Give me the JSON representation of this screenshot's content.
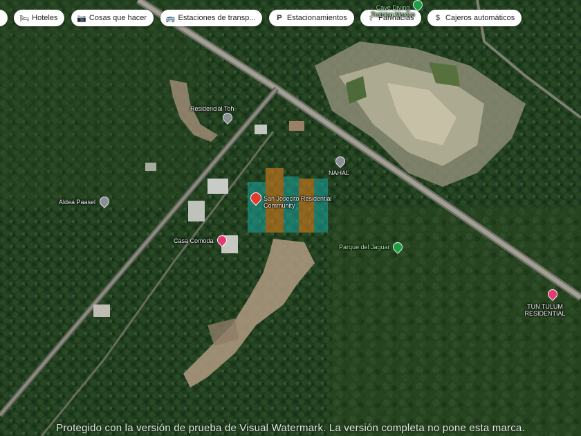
{
  "filters": [
    {
      "label": "tes",
      "icon": "none"
    },
    {
      "label": "Hoteles",
      "icon": "bed-icon"
    },
    {
      "label": "Cosas que hacer",
      "icon": "camera-icon"
    },
    {
      "label": "Estaciones de transp...",
      "icon": "bus-icon"
    },
    {
      "label": "Estacionamientos",
      "icon": "parking-icon"
    },
    {
      "label": "Farmacias",
      "icon": "pharmacy-icon"
    },
    {
      "label": "Cajeros automáticos",
      "icon": "atm-icon"
    }
  ],
  "places": {
    "residencial_toh": "Residencial Toh",
    "nahal": "NAHAL",
    "aldea_paasel": "Aldea Paasel",
    "san_josecito": "San Josecito Residential Community",
    "casa_comoda": "Casa Comoda",
    "parque_jaguar": "Parque del Jaguar",
    "tun_tulum": "TUN TULUM RESIDENTIAL",
    "cave_diving": "Cave Diving Training Mexico"
  },
  "watermark": "Protegido con la versión de prueba de Visual Watermark. La versión completa no pone esta marca.",
  "colors": {
    "forest": "#1e3d1e",
    "clearing": "#a9a58c",
    "road": "#8a8a7e",
    "selected_pin": "#e53b2f",
    "watermark_tile_orange": "#e8821e",
    "watermark_tile_teal": "#1aa6a0"
  }
}
